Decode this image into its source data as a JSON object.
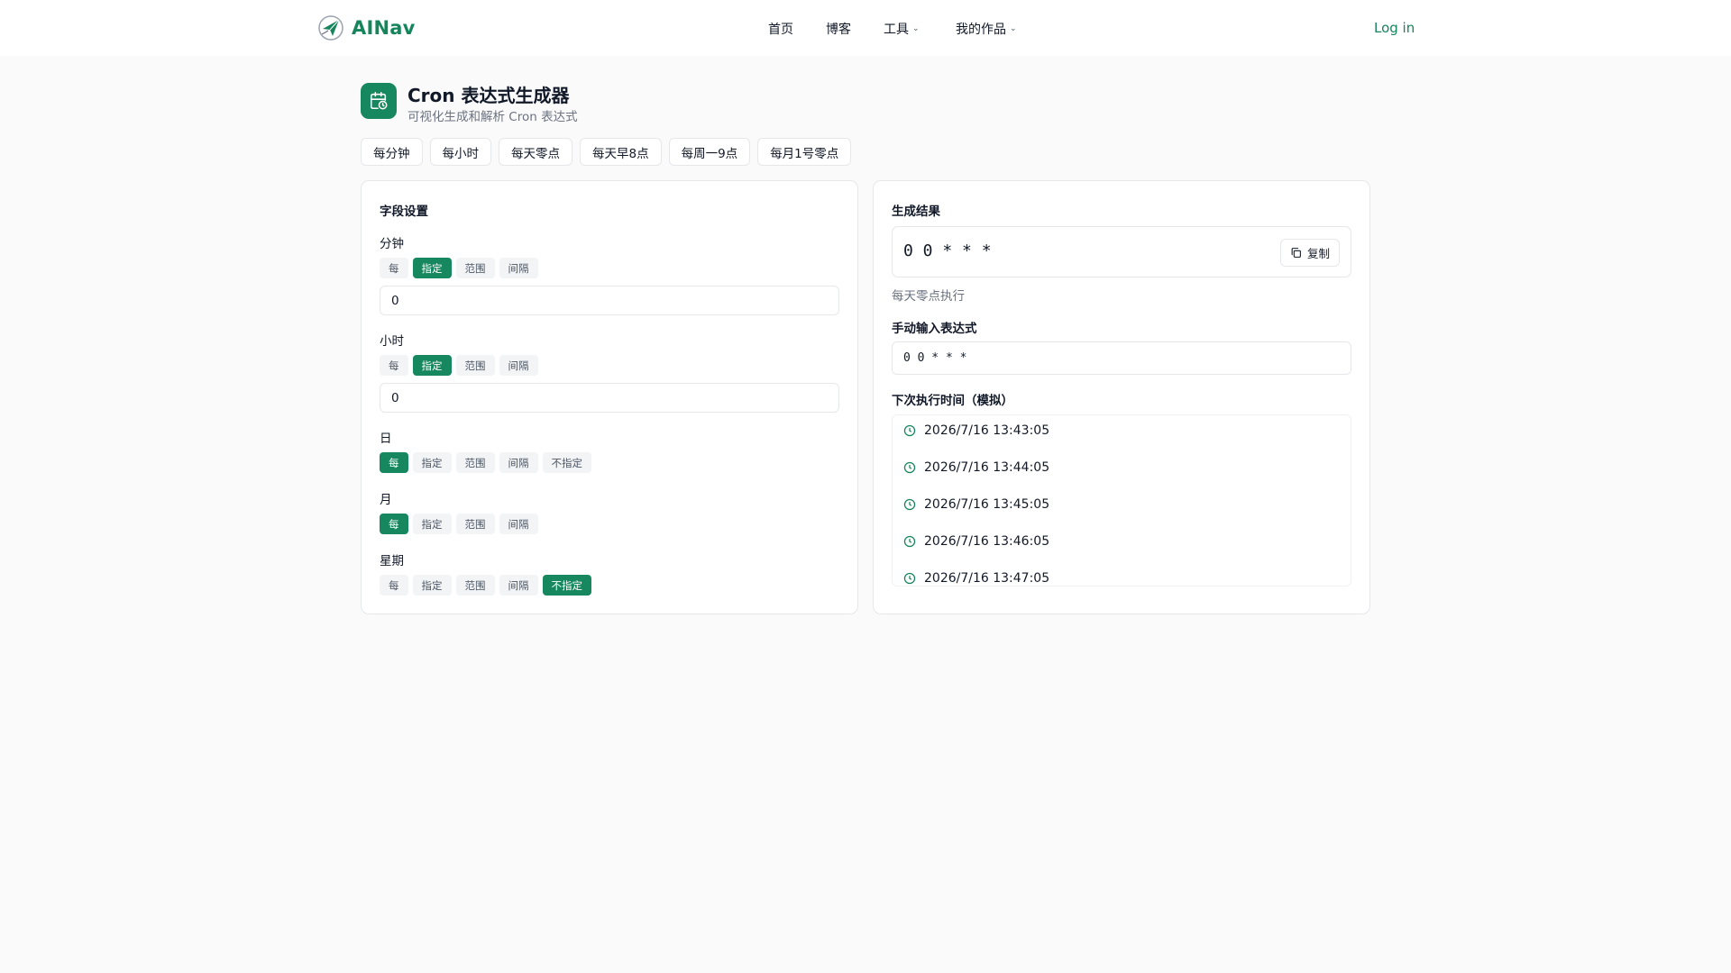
{
  "brand": {
    "name": "AINav",
    "accent": "#16855c"
  },
  "nav": {
    "home": "首页",
    "blog": "博客",
    "tools": "工具",
    "works": "我的作品",
    "login": "Log in"
  },
  "header": {
    "title": "Cron 表达式生成器",
    "subtitle": "可视化生成和解析 Cron 表达式",
    "icon": "calendar-clock-icon"
  },
  "presets": [
    "每分钟",
    "每小时",
    "每天零点",
    "每天早8点",
    "每周一9点",
    "每月1号零点"
  ],
  "fields_panel": {
    "title": "字段设置",
    "fields": [
      {
        "label": "分钟",
        "options": [
          "每",
          "指定",
          "范围",
          "间隔"
        ],
        "selected": "指定",
        "value": "0"
      },
      {
        "label": "小时",
        "options": [
          "每",
          "指定",
          "范围",
          "间隔"
        ],
        "selected": "指定",
        "value": "0"
      },
      {
        "label": "日",
        "options": [
          "每",
          "指定",
          "范围",
          "间隔",
          "不指定"
        ],
        "selected": "每"
      },
      {
        "label": "月",
        "options": [
          "每",
          "指定",
          "范围",
          "间隔"
        ],
        "selected": "每"
      },
      {
        "label": "星期",
        "options": [
          "每",
          "指定",
          "范围",
          "间隔",
          "不指定"
        ],
        "selected": "不指定"
      }
    ]
  },
  "result_panel": {
    "title": "生成结果",
    "expression": "0 0 * * *",
    "copy_label": "复制",
    "description": "每天零点执行",
    "manual_title": "手动输入表达式",
    "manual_value": "0 0 * * *",
    "next_title": "下次执行时间（模拟）",
    "next_times": [
      "2026/7/16 13:43:05",
      "2026/7/16 13:44:05",
      "2026/7/16 13:45:05",
      "2026/7/16 13:46:05",
      "2026/7/16 13:47:05"
    ]
  }
}
